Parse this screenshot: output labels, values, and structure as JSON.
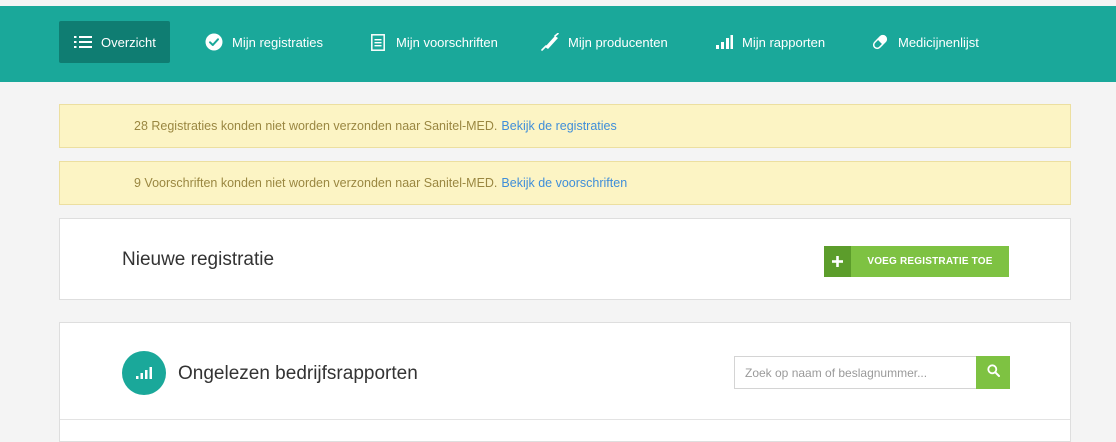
{
  "nav": {
    "items": [
      {
        "label": "Overzicht",
        "icon": "list-icon"
      },
      {
        "label": "Mijn registraties",
        "icon": "check-circle-icon"
      },
      {
        "label": "Mijn voorschriften",
        "icon": "document-icon"
      },
      {
        "label": "Mijn producenten",
        "icon": "syringe-icon"
      },
      {
        "label": "Mijn rapporten",
        "icon": "signal-bars-icon"
      },
      {
        "label": "Medicijnenlijst",
        "icon": "pill-icon"
      }
    ],
    "background_color": "#1aa89a",
    "active_color": "#0f7d72"
  },
  "alerts": [
    {
      "text": "28 Registraties konden niet worden verzonden naar Sanitel-MED.",
      "link": "Bekijk de registraties"
    },
    {
      "text": "9 Voorschriften konden niet worden verzonden naar Sanitel-MED.",
      "link": "Bekijk de voorschriften"
    }
  ],
  "new_registration": {
    "title": "Nieuwe registratie",
    "button_label": "VOEG REGISTRATIE TOE",
    "button_icon": "plus-icon"
  },
  "reports": {
    "title": "Ongelezen bedrijfsrapporten",
    "icon": "signal-bars-icon",
    "search_placeholder": "Zoek op naam of beslagnummer...",
    "search_icon": "search-icon"
  },
  "colors": {
    "alert_bg": "#fcf4c4",
    "alert_text": "#9a8741",
    "link": "#3f8ed9",
    "accent_green": "#7ec242"
  }
}
